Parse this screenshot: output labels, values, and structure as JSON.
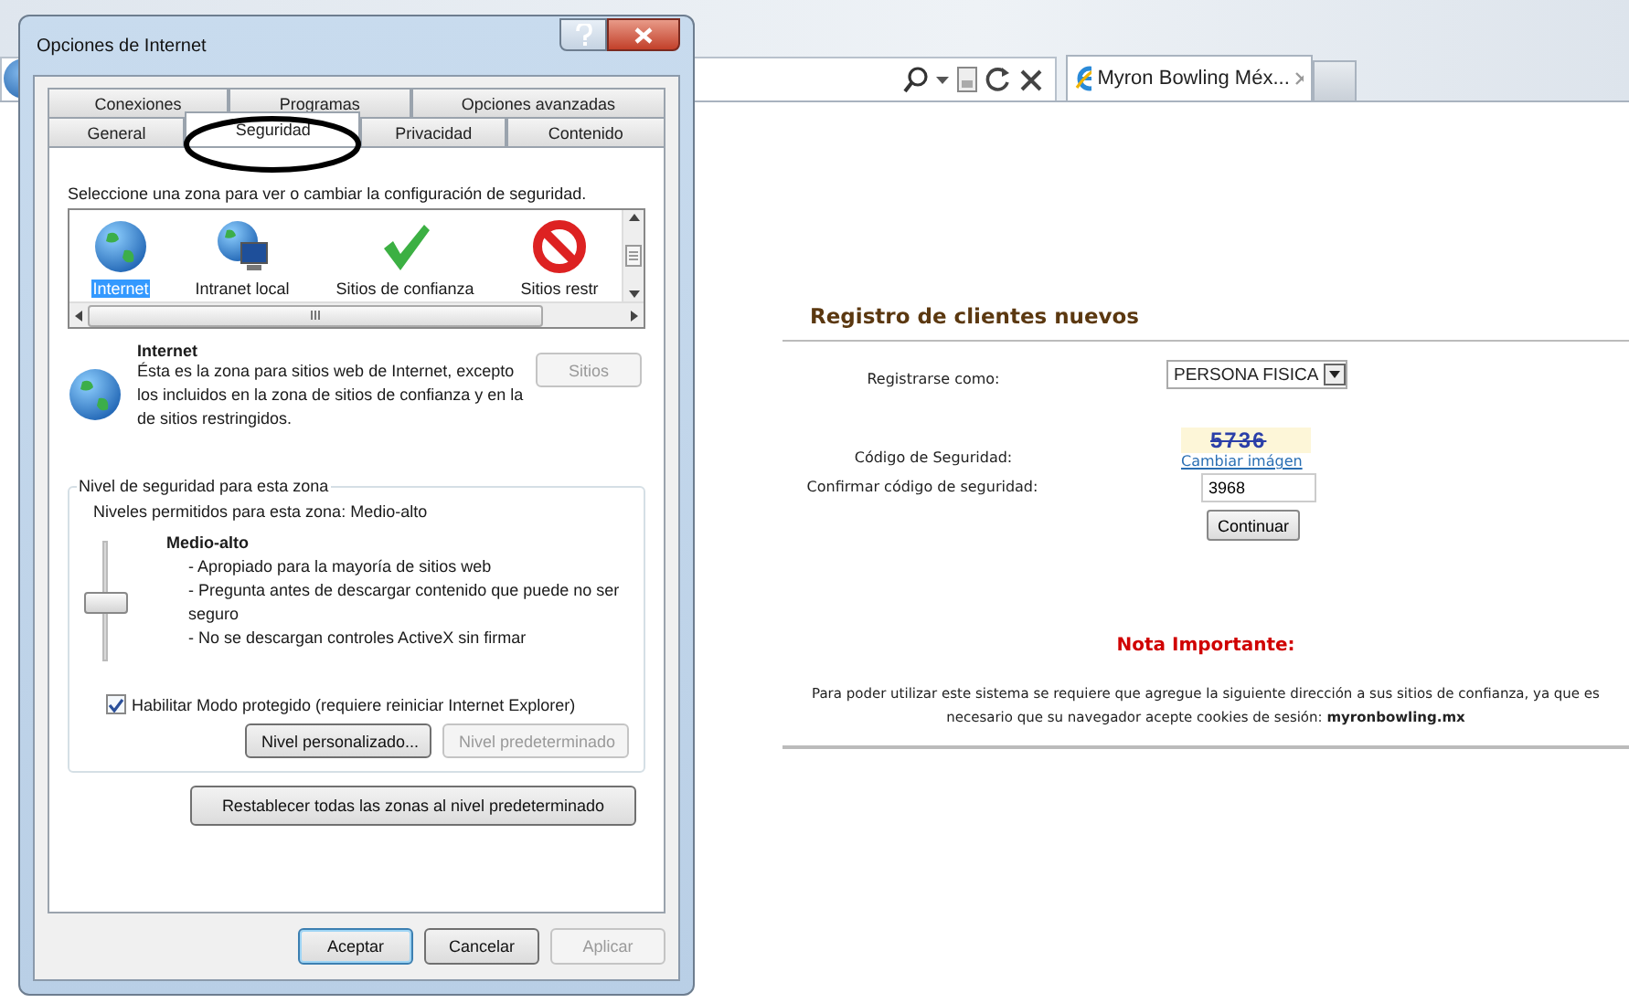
{
  "browser": {
    "tab": {
      "title": "Myron Bowling Méx..."
    }
  },
  "page": {
    "heading": "Registro de clientes nuevos",
    "fields": [
      {
        "kind": "select",
        "label": "Registrarse como:",
        "value": "PERSONA FISICA"
      },
      {
        "kind": "captcha",
        "label": "Código de Seguridad:",
        "captcha": "5736",
        "link": "Cambiar imágen"
      },
      {
        "kind": "input",
        "label": "Confirmar código de seguridad:",
        "value": "3968"
      }
    ],
    "submit": "Continuar",
    "note_title": "Nota Importante:",
    "note": "Para poder utilizar este sistema se requiere que agregue la siguiente dirección a sus sitios de confianza, ya que es necesario que su navegador acepte cookies de sesión: **myronbowling.mx**"
  },
  "dialog": {
    "title": "Opciones de Internet",
    "tab_rows": [
      [
        {
          "label": "Conexiones",
          "selected": false
        },
        {
          "label": "Programas",
          "selected": false
        },
        {
          "label": "Opciones avanzadas",
          "selected": false
        }
      ],
      [
        {
          "label": "General",
          "selected": false
        },
        {
          "label": "Seguridad",
          "selected": true
        },
        {
          "label": "Privacidad",
          "selected": false
        },
        {
          "label": "Contenido",
          "selected": false
        }
      ]
    ],
    "zone_prompt": "Seleccione una zona para ver o cambiar la configuración de seguridad.",
    "zones": [
      {
        "kind": "internet",
        "label": "Internet",
        "selected": true
      },
      {
        "kind": "intranet",
        "label": "Intranet local",
        "selected": false
      },
      {
        "kind": "trusted",
        "label": "Sitios de confianza",
        "selected": false
      },
      {
        "kind": "restricted",
        "label": "Sitios restr",
        "selected": false
      }
    ],
    "zone_name": "Internet",
    "zone_description": "Ésta es la zona para sitios web de Internet, excepto los incluidos en la zona de sitios de confianza y en la de sitios restringidos.",
    "sites_button": {
      "label": "Sitios",
      "disabled": true
    },
    "level_group": {
      "title": "Nivel de seguridad para esta zona",
      "allowed": "Niveles permitidos para esta zona: Medio-alto",
      "level": 0.5,
      "level_name": "Medio-alto",
      "bullets": [
        "- Apropiado para la mayoría de sitios web",
        "- Pregunta antes de descargar contenido que puede no ser seguro",
        "- No se descargan controles ActiveX sin firmar"
      ]
    },
    "protected_mode": {
      "label": "Habilitar Modo protegido (requiere reiniciar Internet Explorer)",
      "checked": true
    },
    "level_buttons": [
      {
        "label": "Nivel personalizado...",
        "disabled": false
      },
      {
        "label": "Nivel predeterminado",
        "disabled": true
      }
    ],
    "reset_button": "Restablecer todas las zonas al nivel predeterminado",
    "footer_buttons": [
      {
        "label": "Aceptar",
        "disabled": false,
        "default": true
      },
      {
        "label": "Cancelar",
        "disabled": false,
        "default": false
      },
      {
        "label": "Aplicar",
        "disabled": true,
        "default": false
      }
    ]
  }
}
